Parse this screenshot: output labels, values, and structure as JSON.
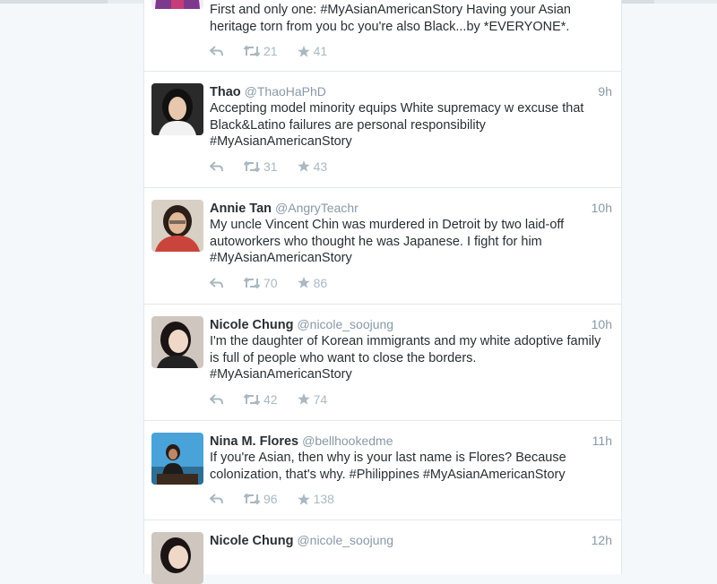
{
  "tweets": [
    {
      "fullname": "",
      "username": "",
      "time": "",
      "text": "First and only one: #MyAsianAmericanStory Having your Asian heritage torn from you bc you're also Black...by *EVERYONE*.",
      "retweets": "21",
      "favorites": "41",
      "avatar_color": "#7d3a8c"
    },
    {
      "fullname": "Thao",
      "username": "@ThaoHaPhD",
      "time": "9h",
      "text": "Accepting model minority equips White supremacy w excuse that Black&Latino failures are personal responsibility #MyAsianAmericanStory",
      "retweets": "31",
      "favorites": "43",
      "avatar_color": "#1c1c1c"
    },
    {
      "fullname": "Annie Tan",
      "username": "@AngryTeachr",
      "time": "10h",
      "text": "My uncle Vincent Chin was murdered in Detroit by two laid-off autoworkers who thought he was Japanese. I fight for him #MyAsianAmericanStory",
      "retweets": "70",
      "favorites": "86",
      "avatar_color": "#c9453c"
    },
    {
      "fullname": "Nicole Chung",
      "username": "@nicole_soojung",
      "time": "10h",
      "text": "I'm the daughter of Korean immigrants and my white adoptive family is full of people who want to close the borders. #MyAsianAmericanStory",
      "retweets": "42",
      "favorites": "74",
      "avatar_color": "#d9cfc9"
    },
    {
      "fullname": "Nina M. Flores",
      "username": "@bellhookedme",
      "time": "11h",
      "text": "If you're Asian, then why is your last name is Flores? Because colonization, that's why. #Philippines #MyAsianAmericanStory",
      "retweets": "96",
      "favorites": "138",
      "avatar_color": "#4aa3d8"
    },
    {
      "fullname": "Nicole Chung",
      "username": "@nicole_soojung",
      "time": "12h",
      "text": "",
      "retweets": "",
      "favorites": "",
      "avatar_color": "#d9cfc9"
    }
  ]
}
